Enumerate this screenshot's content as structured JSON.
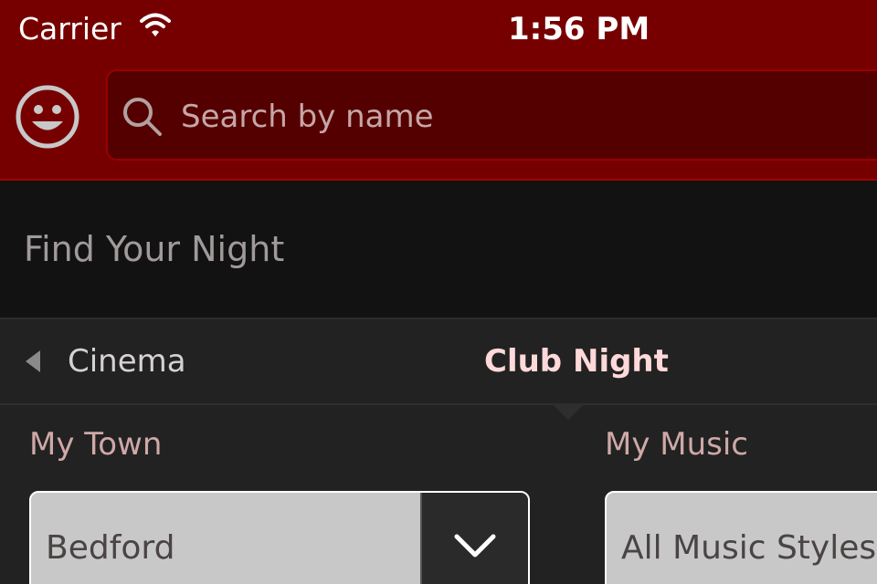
{
  "status_bar": {
    "carrier": "Carrier",
    "time": "1:56 PM"
  },
  "search": {
    "placeholder": "Search by name"
  },
  "page": {
    "title": "Find Your Night"
  },
  "tabs": {
    "previous": "Cinema",
    "active": "Club Night"
  },
  "filters": {
    "town": {
      "label": "My Town",
      "value": "Bedford"
    },
    "music": {
      "label": "My Music",
      "value": "All Music Styles"
    }
  },
  "colors": {
    "header_bg": "#760000",
    "search_bg": "#540000",
    "active_tab": "#ffd9d9",
    "label": "#cfa8a8"
  },
  "icons": {
    "wifi": "wifi-icon",
    "profile": "smiley-icon",
    "search": "search-icon",
    "prev_tab": "arrow-left-icon",
    "dropdown": "chevron-down-icon"
  }
}
